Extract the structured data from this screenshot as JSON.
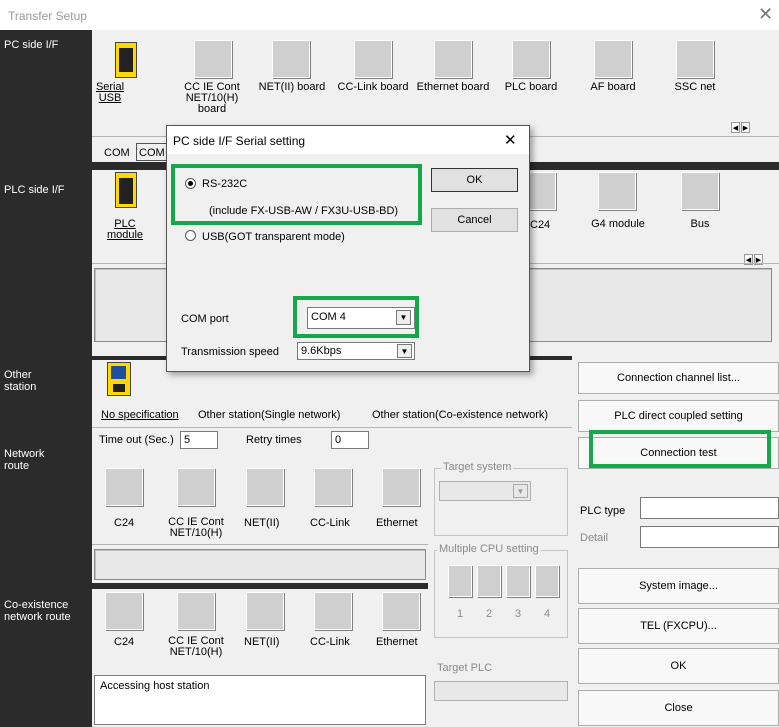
{
  "window": {
    "title": "Transfer Setup",
    "close": "✕"
  },
  "left_labels": {
    "pc": "PC side I/F",
    "plc": "PLC side I/F",
    "other": "Other station",
    "network": "Network route",
    "coexist": "Co-existence network route"
  },
  "pc_side": {
    "items": [
      {
        "label": "Serial USB"
      },
      {
        "label": "CC IE Cont NET/10(H) board"
      },
      {
        "label": "NET(II) board"
      },
      {
        "label": "CC-Link board"
      },
      {
        "label": "Ethernet board"
      },
      {
        "label": "PLC board"
      },
      {
        "label": "AF board"
      },
      {
        "label": "SSC net"
      }
    ],
    "com_text": "COM",
    "com_text2": "COM"
  },
  "plc_side": {
    "items": [
      {
        "label": "PLC module"
      },
      {
        "label": "C24"
      },
      {
        "label": "G4 module"
      },
      {
        "label": "Bus"
      }
    ]
  },
  "other_station": {
    "options": [
      "No specification",
      "Other station(Single network)",
      "Other station(Co-existence network)"
    ]
  },
  "timeout": {
    "label": "Time out (Sec.)",
    "value": "5",
    "retry_label": "Retry times",
    "retry_value": "0"
  },
  "network_route": {
    "items": [
      {
        "label": "C24"
      },
      {
        "label": "CC IE Cont NET/10(H)"
      },
      {
        "label": "NET(II)"
      },
      {
        "label": "CC-Link"
      },
      {
        "label": "Ethernet"
      }
    ]
  },
  "coexist_route": {
    "items": [
      {
        "label": "C24"
      },
      {
        "label": "CC IE Cont NET/10(H)"
      },
      {
        "label": "NET(II)"
      },
      {
        "label": "CC-Link"
      },
      {
        "label": "Ethernet"
      }
    ]
  },
  "status": "Accessing host station",
  "target_system": {
    "label": "Target system"
  },
  "multi_cpu": {
    "label": "Multiple CPU setting",
    "nums": [
      "1",
      "2",
      "3",
      "4"
    ]
  },
  "target_plc": {
    "label": "Target PLC"
  },
  "right_buttons": {
    "channel_list": "Connection channel list...",
    "direct": "PLC direct coupled setting",
    "test": "Connection test",
    "system_image": "System image...",
    "tel": "TEL (FXCPU)...",
    "ok": "OK",
    "close": "Close"
  },
  "plc_type": {
    "label": "PLC type",
    "detail": "Detail"
  },
  "dialog": {
    "title": "PC side I/F  Serial setting",
    "close": "✕",
    "rs232": "RS-232C",
    "rs232_note": "(include FX-USB-AW / FX3U-USB-BD)",
    "usb": "USB(GOT transparent mode)",
    "ok": "OK",
    "cancel": "Cancel",
    "com_label": "COM port",
    "com_value": "COM 4",
    "speed_label": "Transmission speed",
    "speed_value": "9.6Kbps"
  },
  "colors": {
    "highlight": "#15a84a",
    "sidebar": "#2b2b2b"
  }
}
